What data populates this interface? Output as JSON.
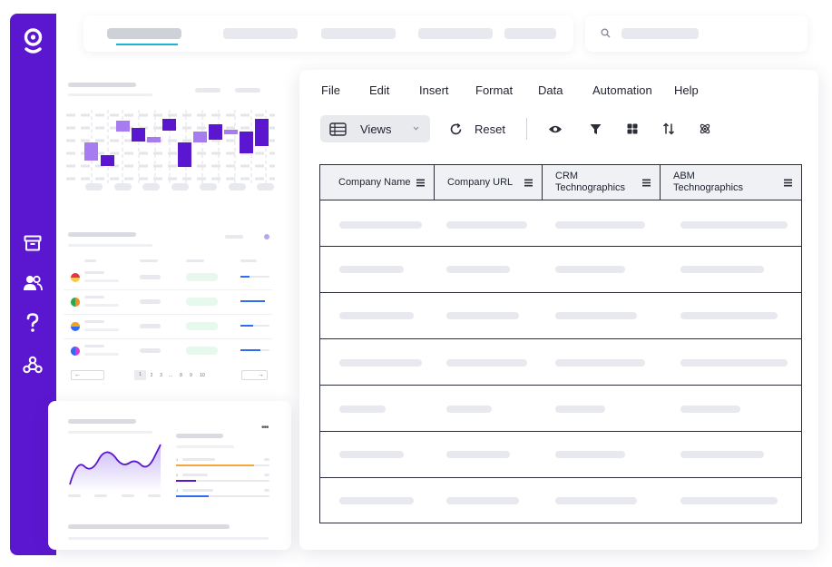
{
  "menu": [
    "File",
    "Edit",
    "Insert",
    "Format",
    "Data",
    "Automation",
    "Help"
  ],
  "toolbar": {
    "views_label": "Views",
    "reset_label": "Reset"
  },
  "columns": [
    "Company Name",
    "Company URL",
    "CRM Technographics",
    "ABM Technographics"
  ],
  "colors": {
    "brand": "#5b17d0",
    "chart_accent": "#a77cf0",
    "chart_dark": "#5b17d0",
    "flag_line": "#2f6cf6",
    "progress_orange": "#f5a63c"
  },
  "mini_pagination": [
    "1",
    "2",
    "3",
    "...",
    "8",
    "9",
    "10"
  ],
  "mini_list_numbers": [
    "1",
    "2",
    "3"
  ],
  "icons": [
    "logo",
    "archive-icon",
    "users-icon",
    "help-icon",
    "webhook-icon",
    "search-icon",
    "table-icon",
    "chevron-down-icon",
    "refresh-icon",
    "eye-icon",
    "filter-icon",
    "grid-icon",
    "sort-icon",
    "atom-icon",
    "menu-lines-icon",
    "more-icon"
  ]
}
